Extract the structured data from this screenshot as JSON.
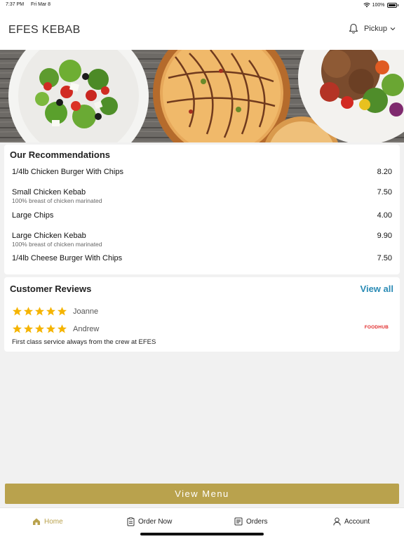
{
  "status_bar": {
    "time": "7:37 PM",
    "date": "Fri Mar 8",
    "battery": "100%"
  },
  "header": {
    "brand": "EFES KEBAB",
    "order_mode": "Pickup"
  },
  "recommendations": {
    "title": "Our Recommendations",
    "items": [
      {
        "name": "1/4lb Chicken Burger With Chips",
        "price": "8.20",
        "description": ""
      },
      {
        "name": "Small Chicken Kebab",
        "price": "7.50",
        "description": "100% breast of chicken marinated"
      },
      {
        "name": "Large Chips",
        "price": "4.00",
        "description": ""
      },
      {
        "name": "Large Chicken Kebab",
        "price": "9.90",
        "description": "100% breast of chicken marinated"
      },
      {
        "name": "1/4lb Cheese Burger With Chips",
        "price": "7.50",
        "description": ""
      }
    ]
  },
  "reviews": {
    "title": "Customer Reviews",
    "view_all": "View all",
    "items": [
      {
        "name": "Joanne",
        "rating": 5,
        "text": ""
      },
      {
        "name": "Andrew",
        "rating": 5,
        "text": "First class service always from the crew at EFES",
        "source": "FOODHUB"
      }
    ]
  },
  "view_menu_label": "View Menu",
  "tabs": [
    {
      "label": "Home",
      "icon": "home-icon",
      "active": true
    },
    {
      "label": "Order Now",
      "icon": "order-icon",
      "active": false
    },
    {
      "label": "Orders",
      "icon": "orders-icon",
      "active": false
    },
    {
      "label": "Account",
      "icon": "account-icon",
      "active": false
    }
  ],
  "colors": {
    "accent": "#b9a24d",
    "link": "#2a8bb5",
    "star": "#f5b400",
    "foodhub": "#e12a2a"
  }
}
